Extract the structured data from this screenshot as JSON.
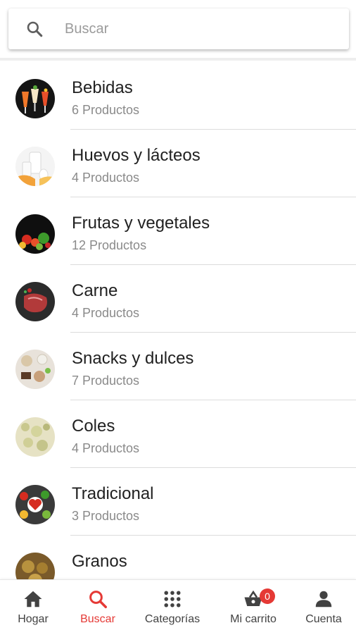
{
  "search": {
    "placeholder": "Buscar",
    "icon": "search-icon"
  },
  "categories": [
    {
      "name": "Bebidas",
      "count": "6 Productos"
    },
    {
      "name": "Huevos y lácteos",
      "count": "4 Productos"
    },
    {
      "name": "Frutas y vegetales",
      "count": "12 Productos"
    },
    {
      "name": "Carne",
      "count": "4 Productos"
    },
    {
      "name": "Snacks y dulces",
      "count": "7 Productos"
    },
    {
      "name": "Coles",
      "count": "4 Productos"
    },
    {
      "name": "Tradicional",
      "count": "3 Productos"
    },
    {
      "name": "Granos",
      "count": ""
    }
  ],
  "bottom_nav": {
    "items": [
      {
        "label": "Hogar",
        "icon": "home-icon"
      },
      {
        "label": "Buscar",
        "icon": "search-icon"
      },
      {
        "label": "Categorías",
        "icon": "grid-icon"
      },
      {
        "label": "Mi carrito",
        "icon": "basket-icon",
        "badge": "0"
      },
      {
        "label": "Cuenta",
        "icon": "person-icon"
      }
    ],
    "active_index": 1
  },
  "colors": {
    "accent": "#e53935",
    "text_primary": "#212121",
    "text_secondary": "#8a8a8a",
    "icon": "#424242"
  }
}
